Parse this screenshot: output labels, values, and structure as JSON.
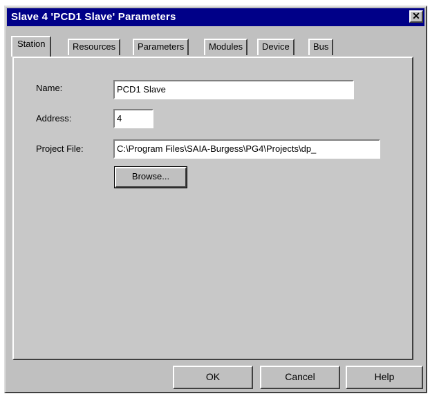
{
  "window": {
    "title": "Slave 4 'PCD1 Slave' Parameters",
    "close_glyph": "✕"
  },
  "tabs": [
    {
      "label": "Station",
      "active": true
    },
    {
      "label": "Resources",
      "active": false
    },
    {
      "label": "Parameters",
      "active": false
    },
    {
      "label": "Modules",
      "active": false
    },
    {
      "label": "Device",
      "active": false
    },
    {
      "label": "Bus",
      "active": false
    }
  ],
  "station": {
    "name_label": "Name:",
    "name_value": "PCD1 Slave",
    "address_label": "Address:",
    "address_value": "4",
    "project_file_label": "Project File:",
    "project_file_value": "C:\\Program Files\\SAIA-Burgess\\PG4\\Projects\\dp_",
    "browse_label": "Browse..."
  },
  "buttons": {
    "ok": "OK",
    "cancel": "Cancel",
    "help": "Help"
  }
}
